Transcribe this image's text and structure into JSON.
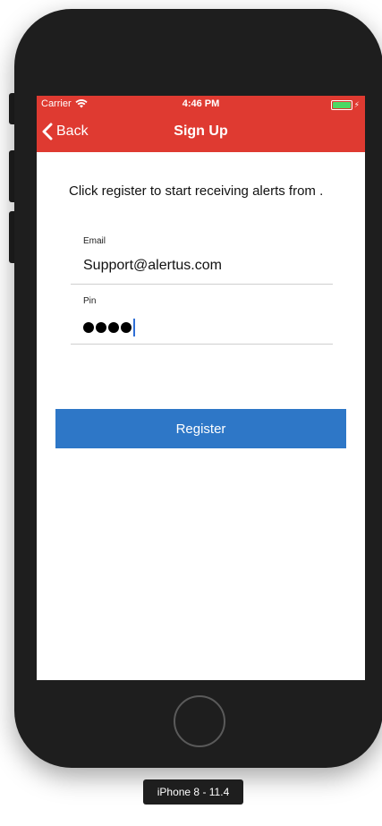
{
  "status_bar": {
    "carrier": "Carrier",
    "wifi_icon": "wifi-icon",
    "time": "4:46 PM",
    "battery_icon": "battery-charging-icon",
    "battery_level": 1.0
  },
  "nav_bar": {
    "back_label": "Back",
    "back_icon": "chevron-left-icon",
    "title": "Sign Up"
  },
  "form": {
    "intro": "Click register to start receiving alerts from .",
    "email": {
      "label": "Email",
      "value": "Support@alertus.com"
    },
    "pin": {
      "label": "Pin",
      "masked_length": 4
    },
    "register_label": "Register"
  },
  "device_label": "iPhone 8 - 11.4",
  "colors": {
    "header": "#df3a31",
    "button": "#2e77c7",
    "device": "#1e1e1e"
  }
}
